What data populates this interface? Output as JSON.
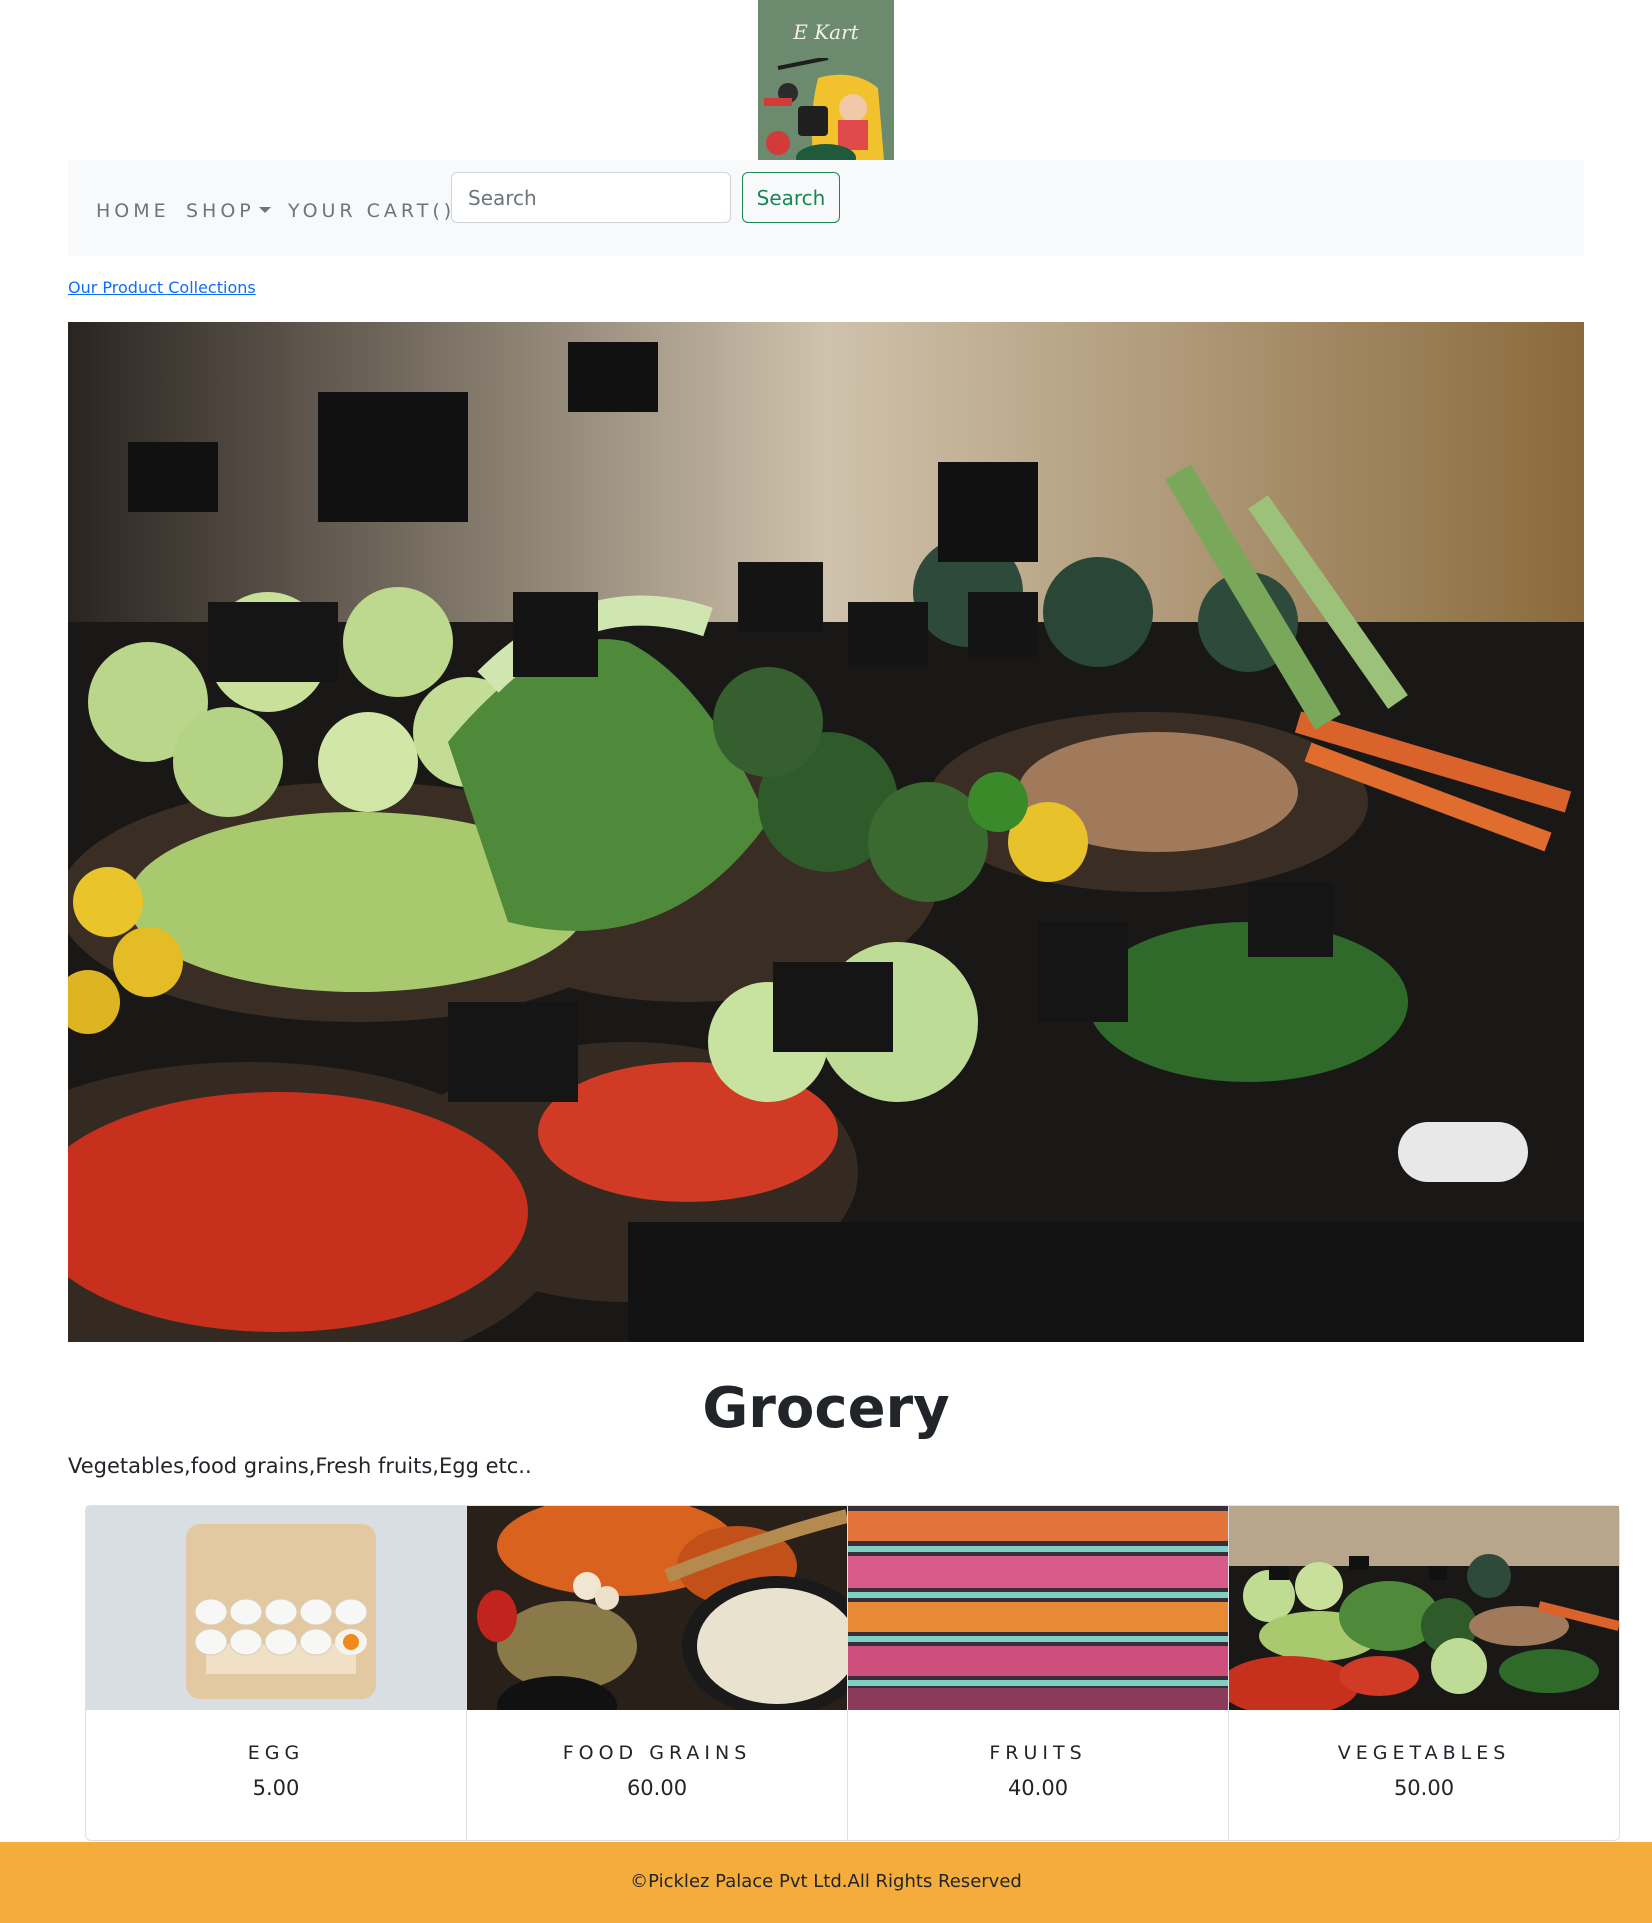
{
  "brand": {
    "logo_text": "E Kart"
  },
  "nav": {
    "home": "HOME",
    "shop": "SHOP",
    "cart": "YOUR CART()",
    "search_placeholder": "Search",
    "search_button": "Search"
  },
  "collections_link": "Our Product Collections",
  "hero": {
    "image": "grocery-vegetables-display"
  },
  "section": {
    "title": "Grocery",
    "description": "Vegetables,food grains,Fresh fruits,Egg etc.."
  },
  "products": [
    {
      "name": "EGG",
      "price": "5.00",
      "image": "egg-carton"
    },
    {
      "name": "FOOD GRAINS",
      "price": "60.00",
      "image": "grains-spices"
    },
    {
      "name": "FRUITS",
      "price": "40.00",
      "image": "fruit-shelves"
    },
    {
      "name": "VEGETABLES",
      "price": "50.00",
      "image": "vegetable-stall"
    }
  ],
  "footer": {
    "text": "©Picklez Palace Pvt Ltd.All Rights Reserved"
  },
  "colors": {
    "footer_bg": "#f4ac3d",
    "search_button": "#198754",
    "link": "#0d6efd",
    "logo_bg": "#6b8a6e"
  }
}
